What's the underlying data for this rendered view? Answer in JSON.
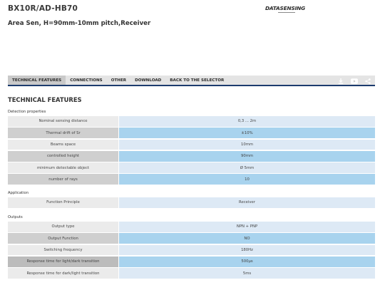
{
  "header": {
    "product_code": "BX10R/AD-HB70",
    "product_description": "Area Sen, H=90mm-10mm pitch,Receiver",
    "brand": "DATASENSING"
  },
  "tabs": [
    {
      "label": "TECHNICAL FEATURES",
      "active": true
    },
    {
      "label": "CONNECTIONS",
      "active": false
    },
    {
      "label": "OTHER",
      "active": false
    },
    {
      "label": "DOWNLOAD",
      "active": false
    },
    {
      "label": "BACK TO THE SELECTOR",
      "active": false
    }
  ],
  "toolbar_icons": [
    "download-icon",
    "youtube-icon",
    "share-icon"
  ],
  "colors": {
    "tabbar_bg": "#e4e4e4",
    "tab_active_bg": "#c9c9c9",
    "tabbar_underline": "#1d3c6e",
    "label_light": "#ebebeb",
    "label_dark": "#cfcfcf",
    "value_light": "#dde9f5",
    "value_dark": "#a8d3ee"
  },
  "section_title": "TECHNICAL FEATURES",
  "groups": [
    {
      "title": "Detection properties",
      "rows": [
        {
          "label": "Nominal sensing distance",
          "value": "0,3 ... 2m"
        },
        {
          "label": "Thermal drift of Sr",
          "value": "±10%"
        },
        {
          "label": "Beams space",
          "value": "10mm"
        },
        {
          "label": "controlled height",
          "value": "90mm"
        },
        {
          "label": "minimum detectable object",
          "value": "Ø 5mm"
        },
        {
          "label": "number of rays",
          "value": "10"
        }
      ]
    },
    {
      "title": "Application",
      "rows": [
        {
          "label": "Function Principle",
          "value": "Receiver"
        }
      ]
    },
    {
      "title": "Outputs",
      "rows": [
        {
          "label": "Output type",
          "value": "NPN + PNP"
        },
        {
          "label": "Output Function",
          "value": "NO"
        },
        {
          "label": "Switching frequency",
          "value": "180Hz"
        },
        {
          "label": "Response time for light/dark transition",
          "value": "500µs"
        },
        {
          "label": "Response time for dark/light transition",
          "value": "5ms"
        }
      ]
    }
  ]
}
